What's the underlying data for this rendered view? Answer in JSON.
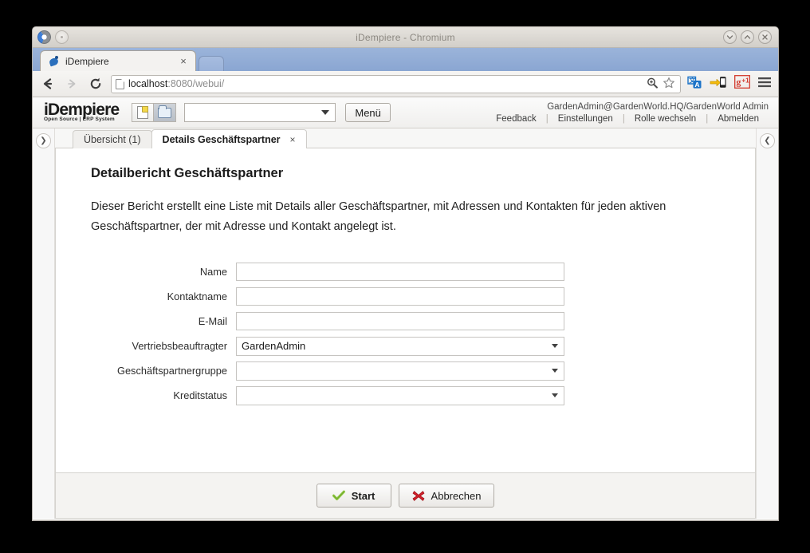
{
  "window": {
    "title": "iDempiere - Chromium",
    "minimize_icon": "chevron-down-icon",
    "maximize_icon": "chevron-up-icon",
    "close_icon": "close-icon"
  },
  "browser": {
    "tab": {
      "title": "iDempiere",
      "close_label": "×",
      "favicon": "idempiere-favicon"
    },
    "new_tab_label": "",
    "nav": {
      "back_icon": "back-arrow-icon",
      "forward_icon": "forward-arrow-icon",
      "reload_icon": "reload-icon"
    },
    "url": {
      "host": "localhost",
      "rest": ":8080/webui/",
      "full": "localhost:8080/webui/"
    },
    "url_icons": {
      "zoom": "zoom-in-icon",
      "bookmark": "star-icon"
    },
    "toolbar_icons": {
      "translate": "translate-icon",
      "send_to_device": "send-to-mobile-icon",
      "gplus": "google-plus-one-icon",
      "menu": "hamburger-menu-icon"
    }
  },
  "app_header": {
    "logo_main": "iDempiere",
    "logo_sub": "Open Source | ERP System",
    "new_icon": "new-document-icon",
    "open_icon": "open-folder-icon",
    "search_select_value": "",
    "menu_button": "Menü",
    "user_info": "GardenAdmin@GardenWorld.HQ/GardenWorld Admin",
    "links": [
      {
        "label": "Feedback"
      },
      {
        "label": "Einstellungen"
      },
      {
        "label": "Rolle wechseln"
      },
      {
        "label": "Abmelden"
      }
    ],
    "link_separator": "|"
  },
  "rails": {
    "left_toggle_icon": "chevron-right-icon",
    "left_toggle_glyph": "❯",
    "right_toggle_icon": "chevron-left-icon",
    "right_toggle_glyph": "❮"
  },
  "tabs": [
    {
      "label": "Übersicht (1)",
      "active": false,
      "closable": false
    },
    {
      "label": "Details Geschäftspartner",
      "active": true,
      "closable": true,
      "close_label": "×"
    }
  ],
  "report": {
    "title": "Detailbericht Geschäftspartner",
    "description": "Dieser Bericht erstellt eine Liste mit Details aller Geschäftspartner, mit Adressen und Kontakten für jeden aktiven Geschäftspartner, der mit Adresse und Kontakt angelegt ist."
  },
  "form": {
    "fields": [
      {
        "label": "Name",
        "type": "text",
        "value": "",
        "placeholder": ""
      },
      {
        "label": "Kontaktname",
        "type": "text",
        "value": "",
        "placeholder": ""
      },
      {
        "label": "E-Mail",
        "type": "text",
        "value": "",
        "placeholder": ""
      },
      {
        "label": "Vertriebsbeauftragter",
        "type": "select",
        "value": "GardenAdmin"
      },
      {
        "label": "Geschäftspartnergruppe",
        "type": "select",
        "value": ""
      },
      {
        "label": "Kreditstatus",
        "type": "select",
        "value": ""
      }
    ]
  },
  "footer": {
    "start_label": "Start",
    "start_icon": "green-check-icon",
    "cancel_label": "Abbrechen",
    "cancel_icon": "red-x-icon"
  },
  "colors": {
    "tabstrip": "#8aa6d2",
    "window_frame": "#d6d3ce",
    "accent_green": "#8cc63f",
    "accent_red": "#d0202a",
    "panel_bg": "#ffffff"
  }
}
